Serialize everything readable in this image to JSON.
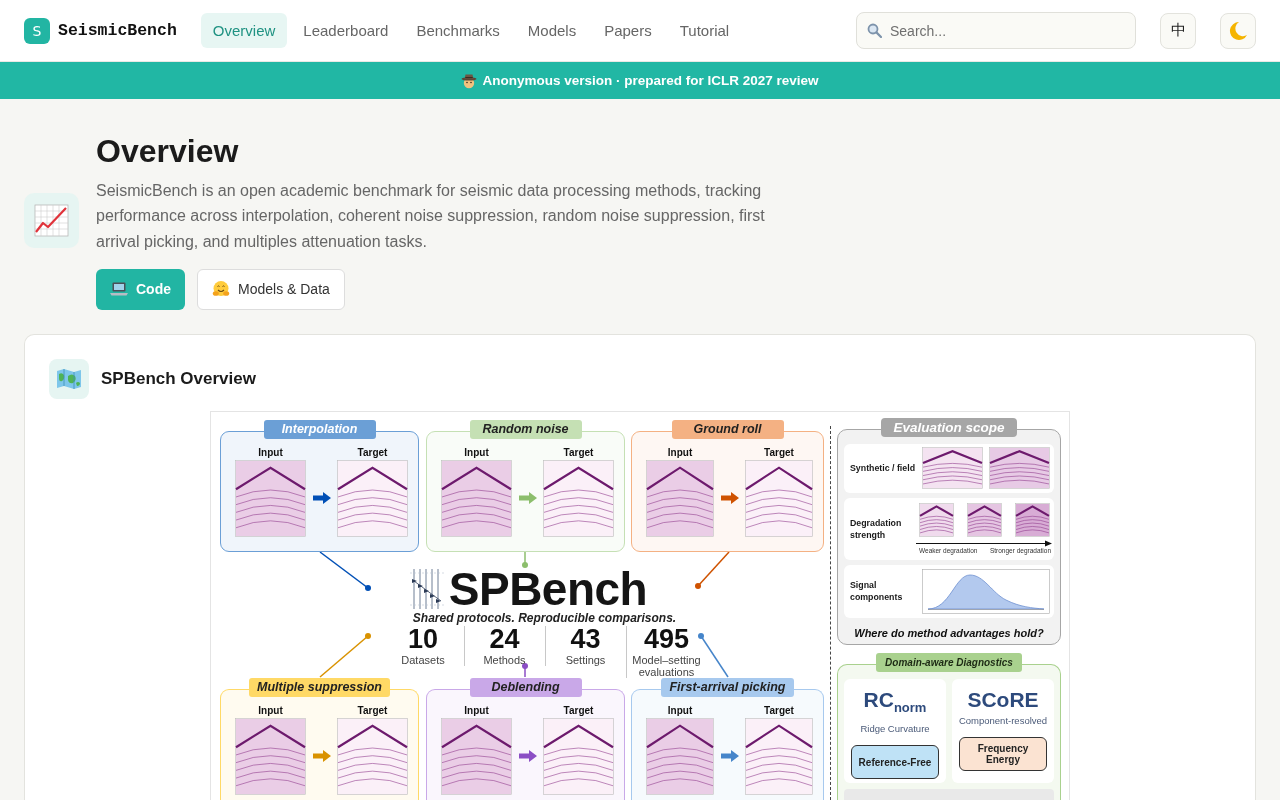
{
  "header": {
    "logo_letter": "S",
    "brand": "SeismicBench",
    "nav": [
      {
        "label": "Overview",
        "selected": true
      },
      {
        "label": "Leaderboard",
        "selected": false
      },
      {
        "label": "Benchmarks",
        "selected": false
      },
      {
        "label": "Models",
        "selected": false
      },
      {
        "label": "Papers",
        "selected": false
      },
      {
        "label": "Tutorial",
        "selected": false
      }
    ],
    "search": {
      "placeholder": "Search..."
    },
    "language_button": "中"
  },
  "banner": {
    "text": "Anonymous version · prepared for ICLR 2027 review"
  },
  "hero": {
    "title": "Overview",
    "description": "SeismicBench is an open academic benchmark for seismic data processing methods, tracking performance across interpolation, coherent noise suppression, random noise suppression, first arrival picking, and multiples attenuation tasks.",
    "buttons": [
      {
        "label": "Code",
        "kind": "code"
      },
      {
        "label": "Models & Data",
        "kind": "hub"
      }
    ]
  },
  "overview_card": {
    "title": "SPBench Overview",
    "figure": {
      "tasks": [
        {
          "title": "Interpolation",
          "color": "#6b9fd6",
          "input_label": "Input",
          "target_label": "Target"
        },
        {
          "title": "Random noise",
          "color": "#c5e0b4",
          "input_label": "Input",
          "target_label": "Target"
        },
        {
          "title": "Ground roll",
          "color": "#f4b183",
          "input_label": "Input",
          "target_label": "Target"
        },
        {
          "title": "Multiple suppression",
          "color": "#ffd966",
          "input_label": "Input",
          "target_label": "Target"
        },
        {
          "title": "Deblending",
          "color": "#c9a8e8",
          "input_label": "Input",
          "target_label": "Target"
        },
        {
          "title": "First-arrival picking",
          "color": "#a7c9ee",
          "input_label": "Input",
          "target_label": "Target"
        }
      ],
      "brand": "SPBench",
      "tagline": "Shared protocols. Reproducible comparisons.",
      "stats": [
        {
          "value": "10",
          "label": "Datasets"
        },
        {
          "value": "24",
          "label": "Methods"
        },
        {
          "value": "43",
          "label": "Settings"
        },
        {
          "value": "495",
          "label": "Model–setting evaluations"
        }
      ],
      "evaluation_scope": {
        "title": "Evaluation scope",
        "rows": [
          {
            "kind": "pair",
            "label": "Synthetic / field"
          },
          {
            "kind": "strength",
            "label": "Degradation strength",
            "scale_labels": [
              "Weaker degradation",
              "Stronger degradation"
            ]
          },
          {
            "kind": "distribution",
            "label": "Signal components"
          }
        ],
        "question": "Where do method advantages hold?"
      },
      "diagnostics": {
        "title": "Domain-aware Diagnostics",
        "metrics": [
          {
            "name": "RC$_{norm}$",
            "description": "Ridge Curvature",
            "tag": "Reference-Free",
            "color": "#bfe2f6"
          },
          {
            "name": "SCoRE",
            "description": "Component-resolved",
            "tag": "Frequency Energy",
            "color": "#fbe3d2"
          }
        ]
      }
    }
  }
}
